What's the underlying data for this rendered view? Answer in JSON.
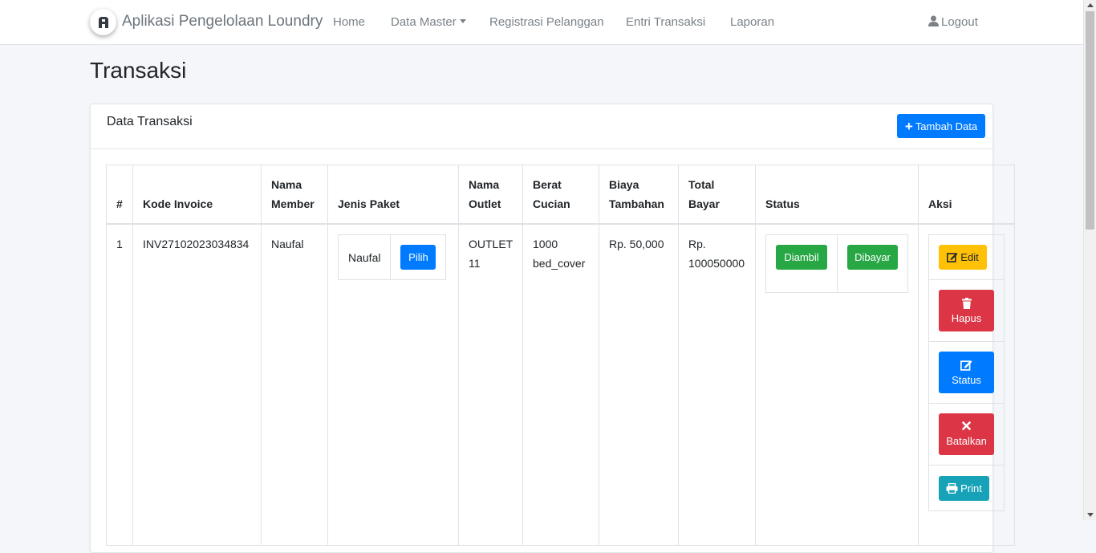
{
  "navbar": {
    "brand": "Aplikasi Pengelolaan Loundry",
    "links": [
      "Home",
      "Data Master",
      "Registrasi Pelanggan",
      "Entri Transaksi",
      "Laporan"
    ],
    "logout": "Logout"
  },
  "page": {
    "title": "Transaksi"
  },
  "card": {
    "title": "Data Transaksi",
    "add_button": "Tambah Data"
  },
  "table": {
    "headers": [
      "#",
      "Kode Invoice",
      "Nama Member",
      "Jenis Paket",
      "Nama Outlet",
      "Berat Cucian",
      "Biaya Tambahan",
      "Total Bayar",
      "Status",
      "Aksi"
    ],
    "rows": [
      {
        "no": "1",
        "kode_invoice": "INV27102023034834",
        "nama_member": "Naufal",
        "jenis_paket": "Naufal",
        "pilih": "Pilih",
        "nama_outlet": "OUTLET 11",
        "berat_cucian": "1000 bed_cover",
        "biaya_tambahan": "Rp. 50,000",
        "total_bayar": "Rp. 100050000",
        "status_diambil": "Diambil",
        "status_dibayar": "Dibayar",
        "aksi": {
          "edit": "Edit",
          "hapus": "Hapus",
          "status": "Status",
          "batalkan": "Batalkan",
          "print": "Print"
        }
      }
    ]
  },
  "colors": {
    "primary": "#007bff",
    "success": "#28a745",
    "warning": "#ffc107",
    "danger": "#dc3545",
    "info": "#17a2b8"
  }
}
